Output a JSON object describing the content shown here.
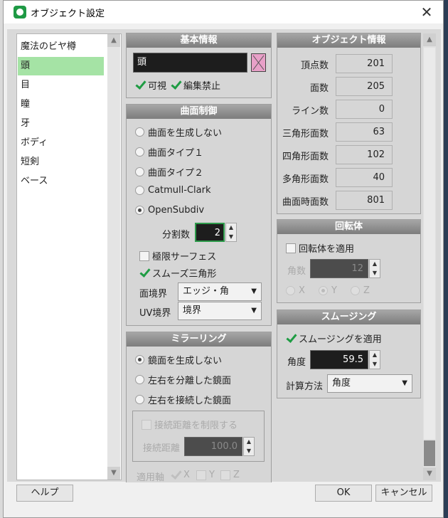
{
  "window": {
    "title": "オブジェクト設定",
    "close": "✕"
  },
  "objects": [
    "魔法のビヤ樽",
    "頭",
    "目",
    "瞳",
    "牙",
    "ボディ",
    "短剣",
    "ベース"
  ],
  "basic": {
    "header": "基本情報",
    "name": "頭",
    "visible": "可視",
    "lock": "編集禁止"
  },
  "surface": {
    "header": "曲面制御",
    "options": [
      "曲面を生成しない",
      "曲面タイプ１",
      "曲面タイプ２",
      "Catmull-Clark",
      "OpenSubdiv"
    ],
    "div_label": "分割数",
    "div_value": "2",
    "limit_surface": "極限サーフェス",
    "smooth_tri": "スムーズ三角形",
    "face_boundary_label": "面境界",
    "face_boundary_value": "エッジ・角",
    "uv_boundary_label": "UV境界",
    "uv_boundary_value": "境界"
  },
  "mirror": {
    "header": "ミラーリング",
    "options": [
      "鏡面を生成しない",
      "左右を分離した鏡面",
      "左右を接続した鏡面"
    ],
    "limit_dist": "接続距離を制限する",
    "dist_label": "接続距離",
    "dist_value": "100.0",
    "axis_label": "適用軸",
    "axes": [
      "X",
      "Y",
      "Z"
    ]
  },
  "info": {
    "header": "オブジェクト情報",
    "rows": [
      {
        "label": "頂点数",
        "value": "201"
      },
      {
        "label": "面数",
        "value": "205"
      },
      {
        "label": "ライン数",
        "value": "0"
      },
      {
        "label": "三角形面数",
        "value": "63"
      },
      {
        "label": "四角形面数",
        "value": "102"
      },
      {
        "label": "多角形面数",
        "value": "40"
      },
      {
        "label": "曲面時面数",
        "value": "801"
      }
    ]
  },
  "lathe": {
    "header": "回転体",
    "apply": "回転体を適用",
    "count_label": "角数",
    "count_value": "12",
    "axes": [
      "X",
      "Y",
      "Z"
    ]
  },
  "smoothing": {
    "header": "スムージング",
    "apply": "スムージングを適用",
    "angle_label": "角度",
    "angle_value": "59.5",
    "method_label": "計算方法",
    "method_value": "角度"
  },
  "buttons": {
    "help": "ヘルプ",
    "ok": "OK",
    "cancel": "キャンセル"
  }
}
